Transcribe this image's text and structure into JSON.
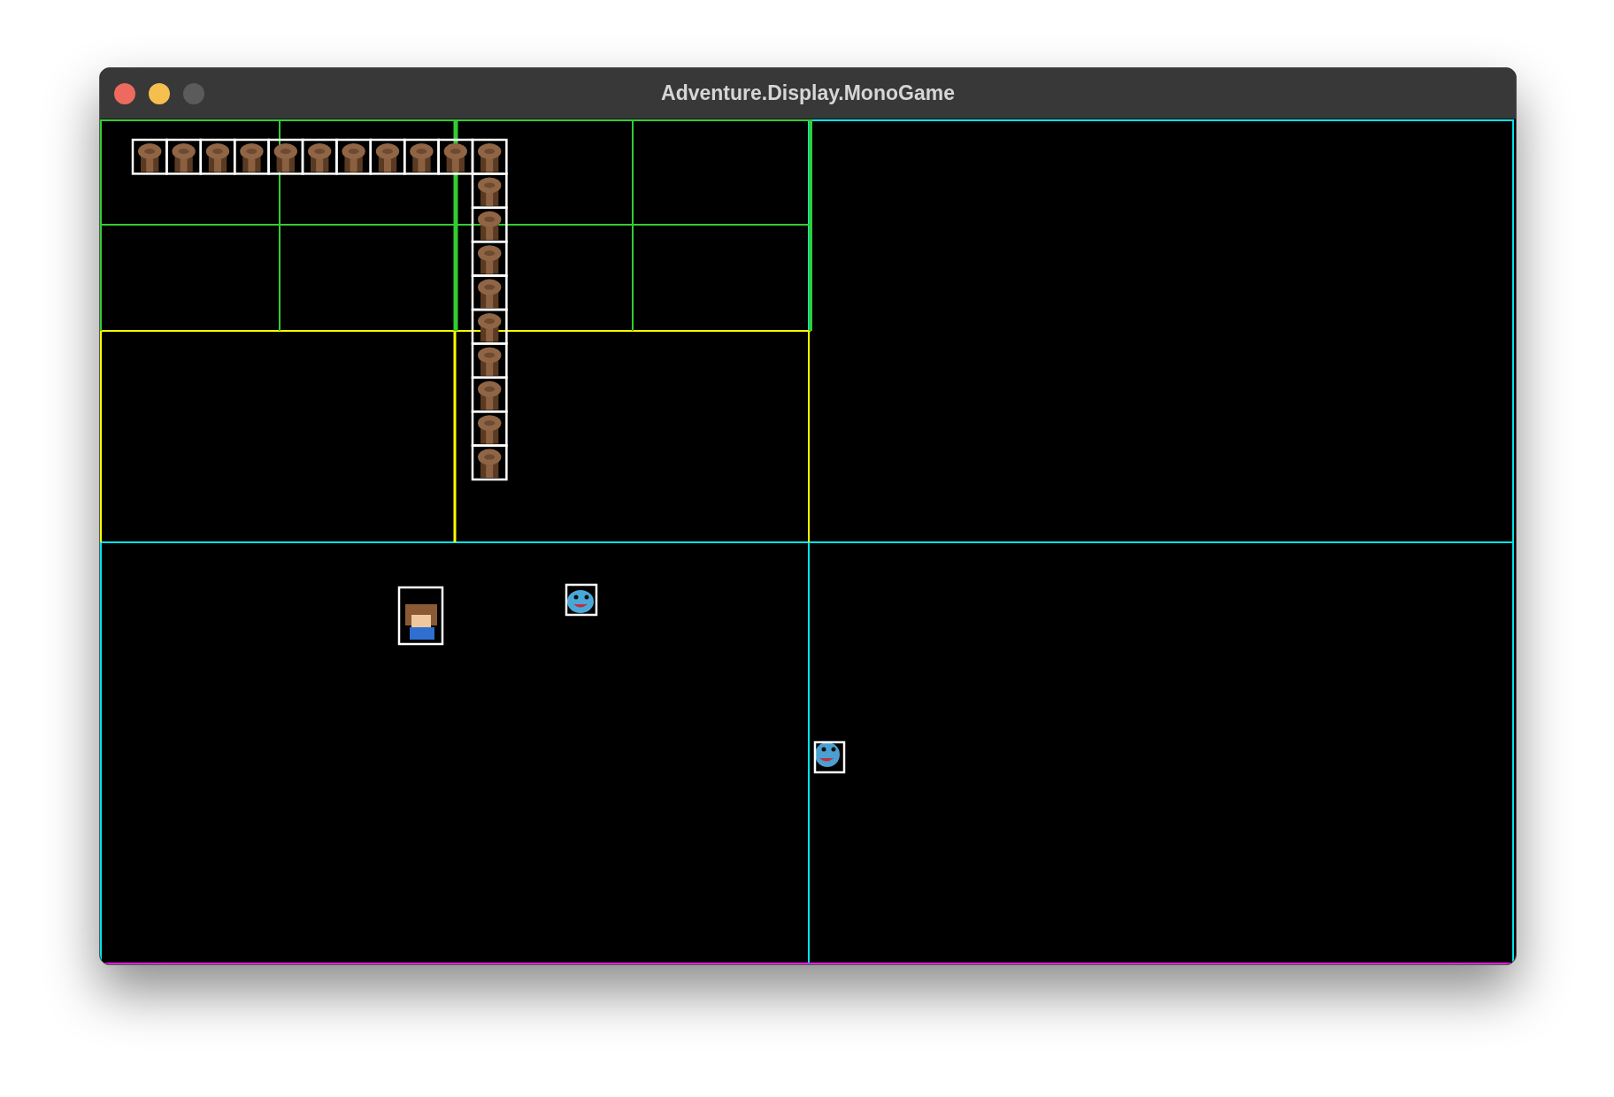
{
  "window": {
    "title": "Adventure.Display.MonoGame"
  }
}
